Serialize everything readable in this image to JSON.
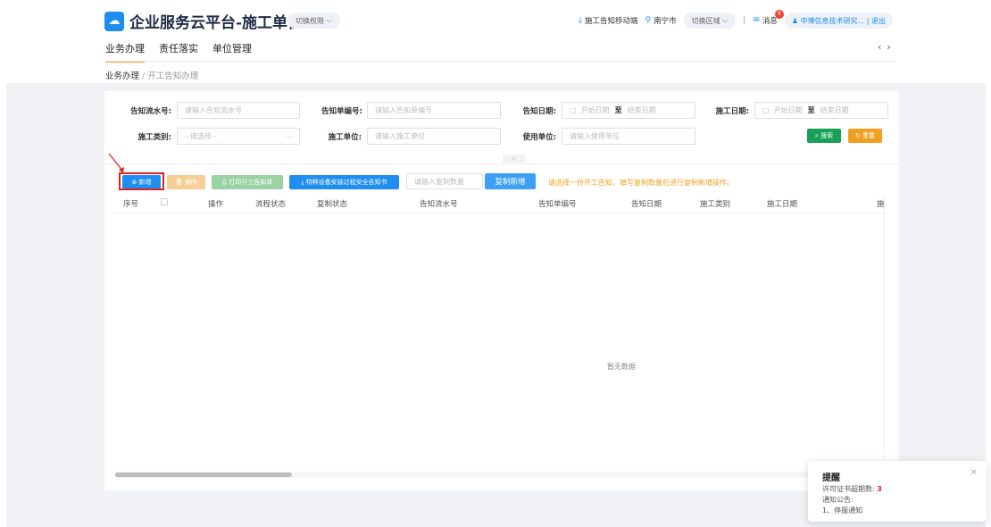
{
  "header": {
    "title": "企业服务云平台-施工单位",
    "switch_perm": "切换权限",
    "mobile": "施工告知移动端",
    "city": "南宁市",
    "switch_area": "切换区域",
    "separator": "|",
    "message": "消息",
    "message_badge": "9",
    "user": "中博信息技术研究...",
    "logout": "| 退出",
    "accent": "#1e8ef0"
  },
  "nav": {
    "items": [
      "业务办理",
      "责任落实",
      "单位管理"
    ],
    "prev_icon": "chevron-left-icon",
    "next_icon": "chevron-right-icon"
  },
  "breadcrumb": {
    "root": "业务办理",
    "sep": "/",
    "current": "开工告知办理"
  },
  "filters": {
    "serial_label": "告知流水号:",
    "serial_placeholder": "请输入告知流水号",
    "order_label": "告知单编号:",
    "order_placeholder": "请输入告知单编号",
    "notify_date_label": "告知日期:",
    "construct_date_label": "施工日期:",
    "start_date": "开始日期",
    "to": "至",
    "end_date": "结束日期",
    "type_label": "施工类别:",
    "type_value": "--请选择--",
    "unit_label": "施工单位:",
    "unit_placeholder": "请输入施工单位",
    "use_unit_label": "使用单位:",
    "use_unit_placeholder": "请输入使用单位",
    "search": "搜索",
    "reset": "重置"
  },
  "toolbar": {
    "add": "新增",
    "delete": "删除",
    "print": "打印开工告知单",
    "special": "特种设备安装过程安全告知书",
    "copy_qty_placeholder": "请输入复制数量",
    "copy_add": "复制新增",
    "tip": "请选择一份开工告知，填写复制数量后进行复制新增操作。"
  },
  "table": {
    "columns": [
      "序号",
      "操作",
      "流程状态",
      "复制状态",
      "告知流水号",
      "告知单编号",
      "告知日期",
      "施工类别",
      "施工日期",
      "施"
    ],
    "empty": "暂无数据"
  },
  "notification": {
    "title": "提醒",
    "permit_label": "许可证书超期数:",
    "permit_count": "3",
    "notice_label": "通知公告:",
    "notice_item": "1、停服通知"
  }
}
